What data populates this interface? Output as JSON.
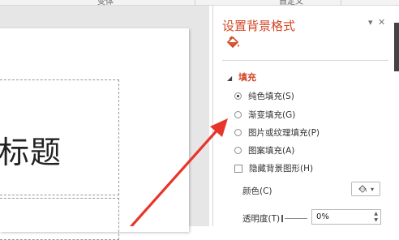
{
  "ribbon": {
    "group_left": "变体",
    "group_right": "自定义"
  },
  "slide": {
    "title_text": "标题"
  },
  "pane": {
    "title": "设置背景格式",
    "dropdown_glyph": "▾",
    "close_glyph": "✕",
    "section": {
      "expand_glyph": "◢",
      "label": "填充"
    },
    "fill_options": [
      {
        "label": "纯色填充(S)",
        "selected": true
      },
      {
        "label": "渐变填充(G)",
        "selected": false
      },
      {
        "label": "图片或纹理填充(P)",
        "selected": false
      },
      {
        "label": "图案填充(A)",
        "selected": false
      }
    ],
    "hide_background_graphics": {
      "label": "隐藏背景图形(H)",
      "checked": false
    },
    "color": {
      "label": "颜色(C)",
      "icon": "paint-bucket-icon",
      "dropdown_glyph": "▾"
    },
    "transparency": {
      "label": "透明度(T)",
      "value": "0%",
      "up_glyph": "▲",
      "down_glyph": "▼"
    }
  },
  "colors": {
    "accent": "#d24726",
    "arrow": "#e8352b"
  }
}
